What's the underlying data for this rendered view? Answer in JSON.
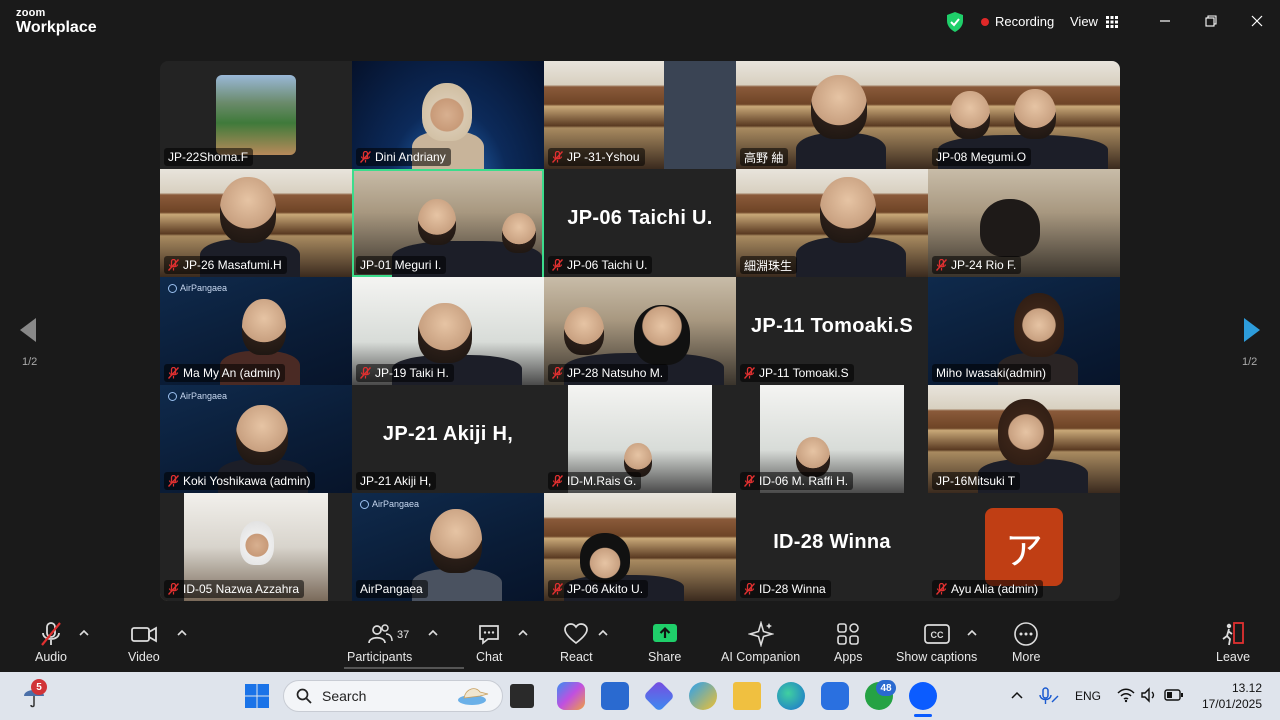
{
  "app": {
    "logo_top": "zoom",
    "logo_bottom": "Workplace",
    "recording_label": "Recording",
    "view_label": "View"
  },
  "pagination": {
    "left_label": "1/2",
    "right_label": "1/2"
  },
  "tiles": [
    {
      "name": "JP-22Shoma.F",
      "muted": false,
      "big": ""
    },
    {
      "name": "Dini Andriany",
      "muted": true,
      "big": ""
    },
    {
      "name": "JP -31-Yshou",
      "muted": true,
      "big": ""
    },
    {
      "name": "高野 紬",
      "muted": false,
      "big": ""
    },
    {
      "name": "JP-08 Megumi.O",
      "muted": false,
      "big": ""
    },
    {
      "name": "JP-26 Masafumi.H",
      "muted": true,
      "big": ""
    },
    {
      "name": "JP-01 Meguri I.",
      "muted": false,
      "big": ""
    },
    {
      "name": "JP-06 Taichi U.",
      "muted": true,
      "big": "JP-06 Taichi U."
    },
    {
      "name": "細淵珠生",
      "muted": false,
      "big": ""
    },
    {
      "name": "JP-24 Rio F.",
      "muted": true,
      "big": ""
    },
    {
      "name": "Ma My An (admin)",
      "muted": true,
      "big": ""
    },
    {
      "name": "JP-19 Taiki H.",
      "muted": true,
      "big": ""
    },
    {
      "name": "JP-28 Natsuho M.",
      "muted": true,
      "big": ""
    },
    {
      "name": "JP-11 Tomoaki.S",
      "muted": true,
      "big": "JP-11 Tomoaki.S"
    },
    {
      "name": "Miho Iwasaki(admin)",
      "muted": false,
      "big": ""
    },
    {
      "name": "Koki Yoshikawa (admin)",
      "muted": true,
      "big": ""
    },
    {
      "name": "JP-21 Akiji H,",
      "muted": false,
      "big": "JP-21 Akiji H,"
    },
    {
      "name": "ID-M.Rais G.",
      "muted": true,
      "big": ""
    },
    {
      "name": "ID-06 M. Raffi H.",
      "muted": true,
      "big": ""
    },
    {
      "name": "JP-16Mitsuki T",
      "muted": false,
      "big": ""
    },
    {
      "name": "ID-05 Nazwa Azzahra",
      "muted": true,
      "big": ""
    },
    {
      "name": "AirPangaea",
      "muted": false,
      "big": ""
    },
    {
      "name": "JP-06 Akito U.",
      "muted": true,
      "big": ""
    },
    {
      "name": "ID-28 Winna",
      "muted": true,
      "big": "ID-28 Winna"
    },
    {
      "name": "Ayu Alia (admin)",
      "muted": true,
      "big": ""
    }
  ],
  "air_brand": "AirPangaea",
  "avatar_letter": "ア",
  "toolbar": {
    "audio": "Audio",
    "video": "Video",
    "participants": "Participants",
    "participants_count": "37",
    "chat": "Chat",
    "react": "React",
    "share": "Share",
    "ai_companion": "AI Companion",
    "apps": "Apps",
    "captions": "Show captions",
    "more": "More",
    "leave": "Leave"
  },
  "taskbar": {
    "search_placeholder": "Search",
    "weather_badge": "5",
    "whatsapp_badge": "48",
    "language": "ENG",
    "time": "13.12",
    "date": "17/01/2025"
  },
  "colors": {
    "active_speaker": "#3cdc8c",
    "recording_dot": "#e02828",
    "mute_red": "#e03030",
    "share_green": "#1fcf6a",
    "nav_arrow_blue": "#2d9cdb",
    "avatar_orange": "#c03e14"
  }
}
